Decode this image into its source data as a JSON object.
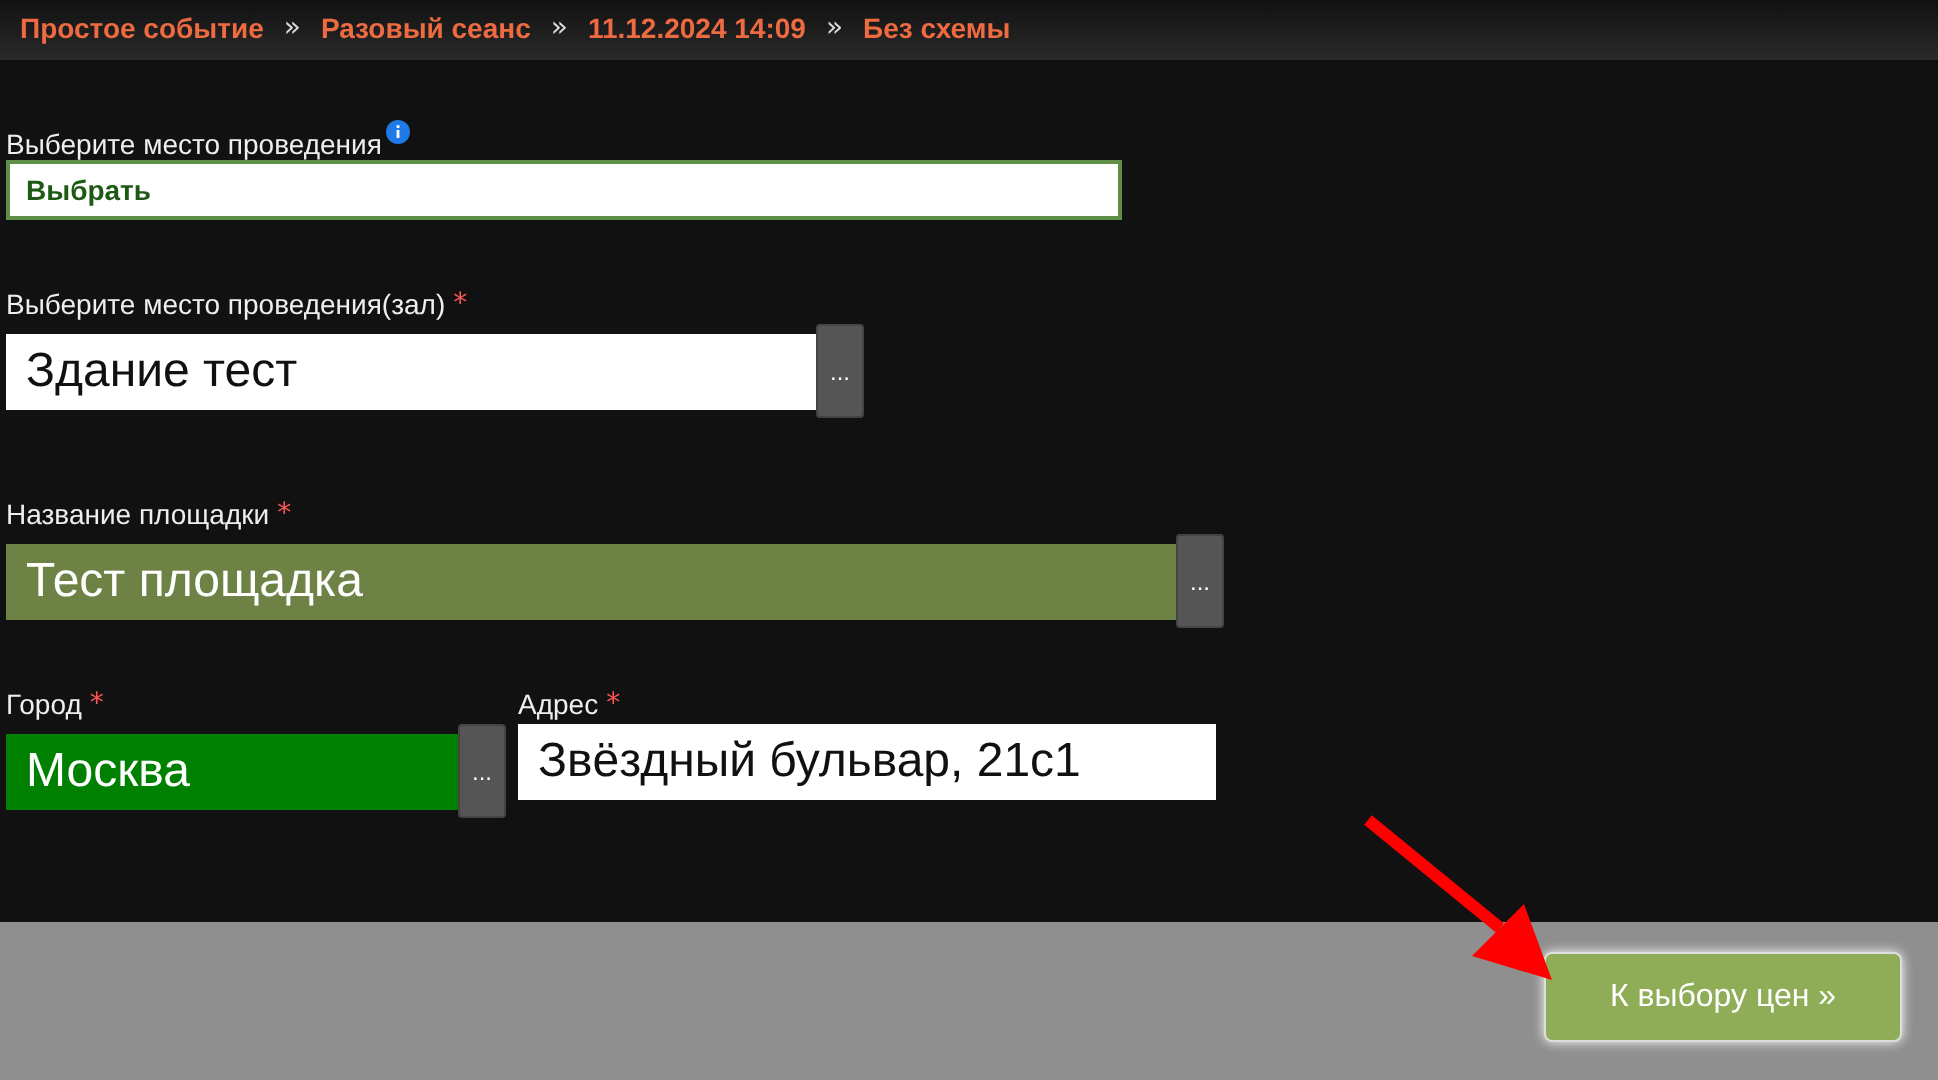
{
  "breadcrumbs": [
    {
      "label": "Простое событие",
      "separator": "»"
    },
    {
      "label": "Разовый сеанс",
      "separator": "»"
    },
    {
      "label": "11.12.2024 14:09",
      "separator": "»"
    },
    {
      "label": "Без схемы"
    }
  ],
  "venue_select": {
    "label": "Выберите место проведения",
    "value": "Выбрать"
  },
  "fields": [
    {
      "label": "Выберите место проведения(зал)",
      "required_mark": "*",
      "value": "Здание тест",
      "color": "#ffffff",
      "picker": "..."
    },
    {
      "label": "Название площадки",
      "required_mark": "*",
      "value": "Тест площадка",
      "color": "#6f8245",
      "picker": "..."
    }
  ],
  "city": {
    "label": "Город",
    "required_mark": "*",
    "value": "Москва",
    "color": "#008000",
    "picker": "..."
  },
  "address": {
    "label": "Адрес",
    "required_mark": "*",
    "value": "Звёздный бульвар, 21с1",
    "color": "#ffffff"
  },
  "next_button": "К выбору цен »"
}
